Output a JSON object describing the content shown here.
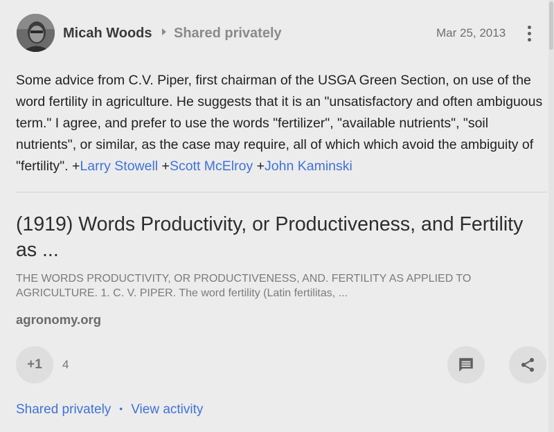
{
  "post": {
    "author": "Micah Woods",
    "visibility": "Shared privately",
    "date": "Mar 25, 2013",
    "text_parts": {
      "body": "Some advice from C.V. Piper, first chairman of the USGA Green Section, on use of the word fertility in agriculture. He suggests that it is an \"unsatisfactory and often ambiguous term.\" I agree, and prefer to use the words \"fertilizer\", \"available nutrients\", \"soil nutrients\", or similar, as the case may require, all of which which avoid the ambiguity of \"fertility\". ",
      "plus1": "+",
      "mention1": "Larry Stowell",
      "plus2": " +",
      "mention2": "Scott McElroy",
      "plus3": " +",
      "mention3": "John Kaminski"
    }
  },
  "link": {
    "title": "(1919) Words Productivity, or Productiveness, and Fertility as ...",
    "snippet": "THE WORDS PRODUCTIVITY, OR PRODUCTIVENESS, AND. FERTILITY AS APPLIED TO AGRICULTURE. 1. C. V. PIPER. The word fertility (Latin fertilitas, ...",
    "domain": "agronomy.org"
  },
  "actions": {
    "plusone_label": "+1",
    "plusone_count": "4"
  },
  "footer": {
    "shared": "Shared privately",
    "separator": "•",
    "view_activity": "View activity"
  },
  "icons": {
    "avatar": "avatar-photo",
    "more": "more-vertical-icon",
    "comment": "comment-icon",
    "share": "share-icon"
  }
}
